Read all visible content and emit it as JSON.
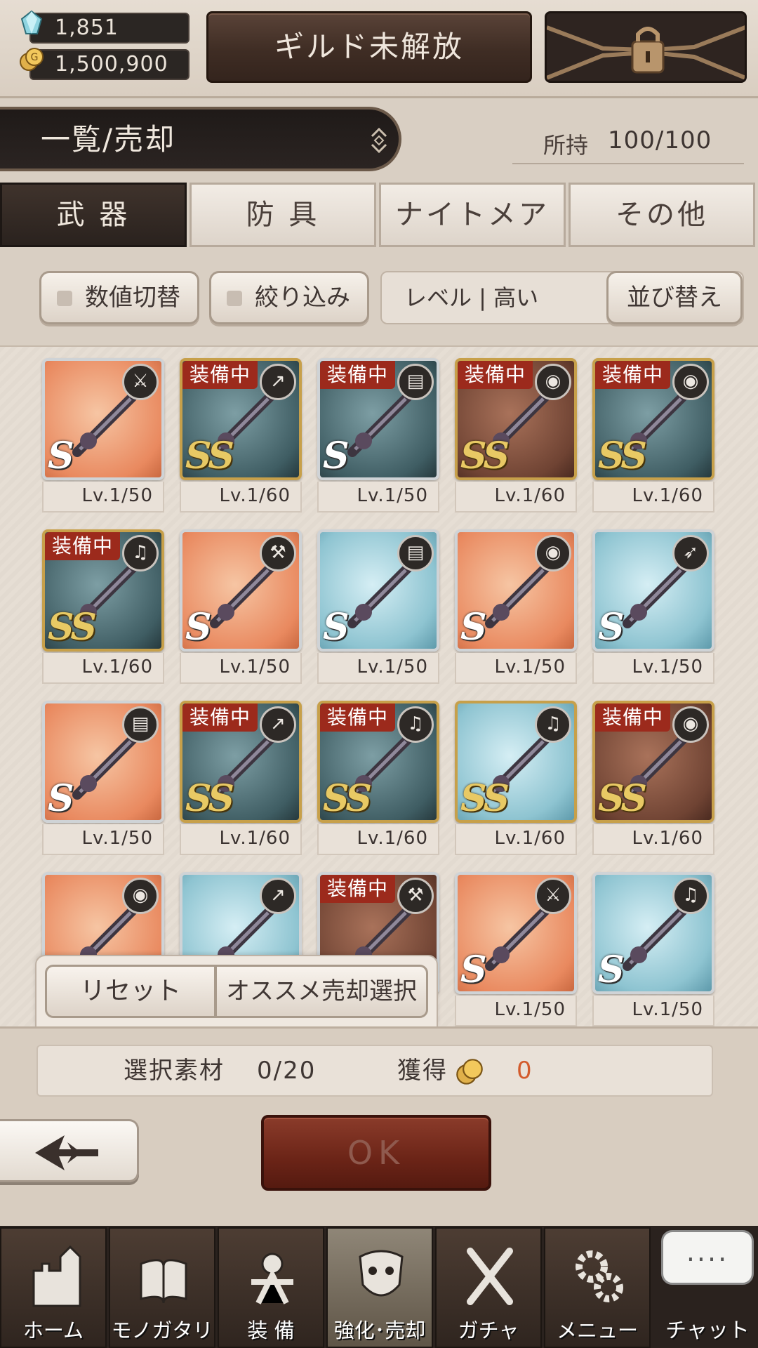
{
  "currency": {
    "crystals": "1,851",
    "gold": "1,500,900"
  },
  "header": {
    "guild_label": "ギルド未解放"
  },
  "category": {
    "title": "一覧/売却",
    "possess_label": "所持",
    "possess_value": "100/100"
  },
  "tabs": [
    {
      "label": "武 器",
      "active": true
    },
    {
      "label": "防 具",
      "active": false
    },
    {
      "label": "ナイトメア",
      "active": false
    },
    {
      "label": "その他",
      "active": false
    }
  ],
  "filters": {
    "toggle_values_label": "数値切替",
    "filter_label": "絞り込み",
    "sort_current": "レベル | 高い",
    "sort_button_label": "並び替え"
  },
  "items": [
    {
      "rank": "S",
      "bg": "orange",
      "type": "sword-icon",
      "equipped": false,
      "level": "Lv.1/50"
    },
    {
      "rank": "SS",
      "bg": "dark",
      "type": "spear-icon",
      "equipped": true,
      "level": "Lv.1/60"
    },
    {
      "rank": "S",
      "bg": "dark",
      "type": "tome-icon",
      "equipped": true,
      "level": "Lv.1/50"
    },
    {
      "rank": "SS",
      "bg": "brown",
      "type": "orb-icon",
      "equipped": true,
      "level": "Lv.1/60"
    },
    {
      "rank": "SS",
      "bg": "dark",
      "type": "orb-icon",
      "equipped": true,
      "level": "Lv.1/60"
    },
    {
      "rank": "SS",
      "bg": "dark",
      "type": "harp-icon",
      "equipped": true,
      "level": "Lv.1/60"
    },
    {
      "rank": "S",
      "bg": "orange",
      "type": "hammer-icon",
      "equipped": false,
      "level": "Lv.1/50"
    },
    {
      "rank": "S",
      "bg": "blue",
      "type": "tome-icon",
      "equipped": false,
      "level": "Lv.1/50"
    },
    {
      "rank": "S",
      "bg": "orange",
      "type": "orb-icon",
      "equipped": false,
      "level": "Lv.1/50"
    },
    {
      "rank": "S",
      "bg": "blue",
      "type": "bow-icon",
      "equipped": false,
      "level": "Lv.1/50"
    },
    {
      "rank": "S",
      "bg": "orange",
      "type": "tome-icon",
      "equipped": false,
      "level": "Lv.1/50"
    },
    {
      "rank": "SS",
      "bg": "dark",
      "type": "spear-icon",
      "equipped": true,
      "level": "Lv.1/60"
    },
    {
      "rank": "SS",
      "bg": "dark",
      "type": "harp-icon",
      "equipped": true,
      "level": "Lv.1/60"
    },
    {
      "rank": "SS",
      "bg": "blue",
      "type": "harp-icon",
      "equipped": false,
      "level": "Lv.1/60"
    },
    {
      "rank": "SS",
      "bg": "brown",
      "type": "orb-icon",
      "equipped": true,
      "level": "Lv.1/60"
    },
    {
      "rank": "",
      "bg": "orange",
      "type": "orb-icon",
      "equipped": false,
      "level": ""
    },
    {
      "rank": "",
      "bg": "blue",
      "type": "spear-icon",
      "equipped": false,
      "level": ""
    },
    {
      "rank": "",
      "bg": "brown",
      "type": "hammer-icon",
      "equipped": true,
      "level": ""
    },
    {
      "rank": "S",
      "bg": "orange",
      "type": "sword-icon",
      "equipped": false,
      "level": "Lv.1/50"
    },
    {
      "rank": "S",
      "bg": "blue",
      "type": "harp-icon",
      "equipped": false,
      "level": "Lv.1/50"
    }
  ],
  "equipped_badge": "装備中",
  "actions": {
    "reset_label": "リセット",
    "recommend_label": "オススメ売却選択"
  },
  "selection": {
    "materials_label": "選択素材",
    "materials_value": "0/20",
    "gain_label": "獲得",
    "gain_value": "0"
  },
  "ok_label": "OK",
  "nav": [
    {
      "label": "ホーム",
      "icon": "castle-icon",
      "active": false
    },
    {
      "label": "モノガタリ",
      "icon": "book-icon",
      "active": false
    },
    {
      "label": "装 備",
      "icon": "puppet-icon",
      "active": false
    },
    {
      "label": "強化･売却",
      "icon": "mask-icon",
      "active": true
    },
    {
      "label": "ガチャ",
      "icon": "crossed-swords-icon",
      "active": false
    },
    {
      "label": "メニュー",
      "icon": "gears-icon",
      "active": false
    }
  ],
  "chat": {
    "bubble": "....",
    "label": "チャット"
  },
  "colors": {
    "accent_red": "#9c2a1c",
    "gain_orange": "#d35b2c",
    "frame_dark": "#2a221e"
  }
}
